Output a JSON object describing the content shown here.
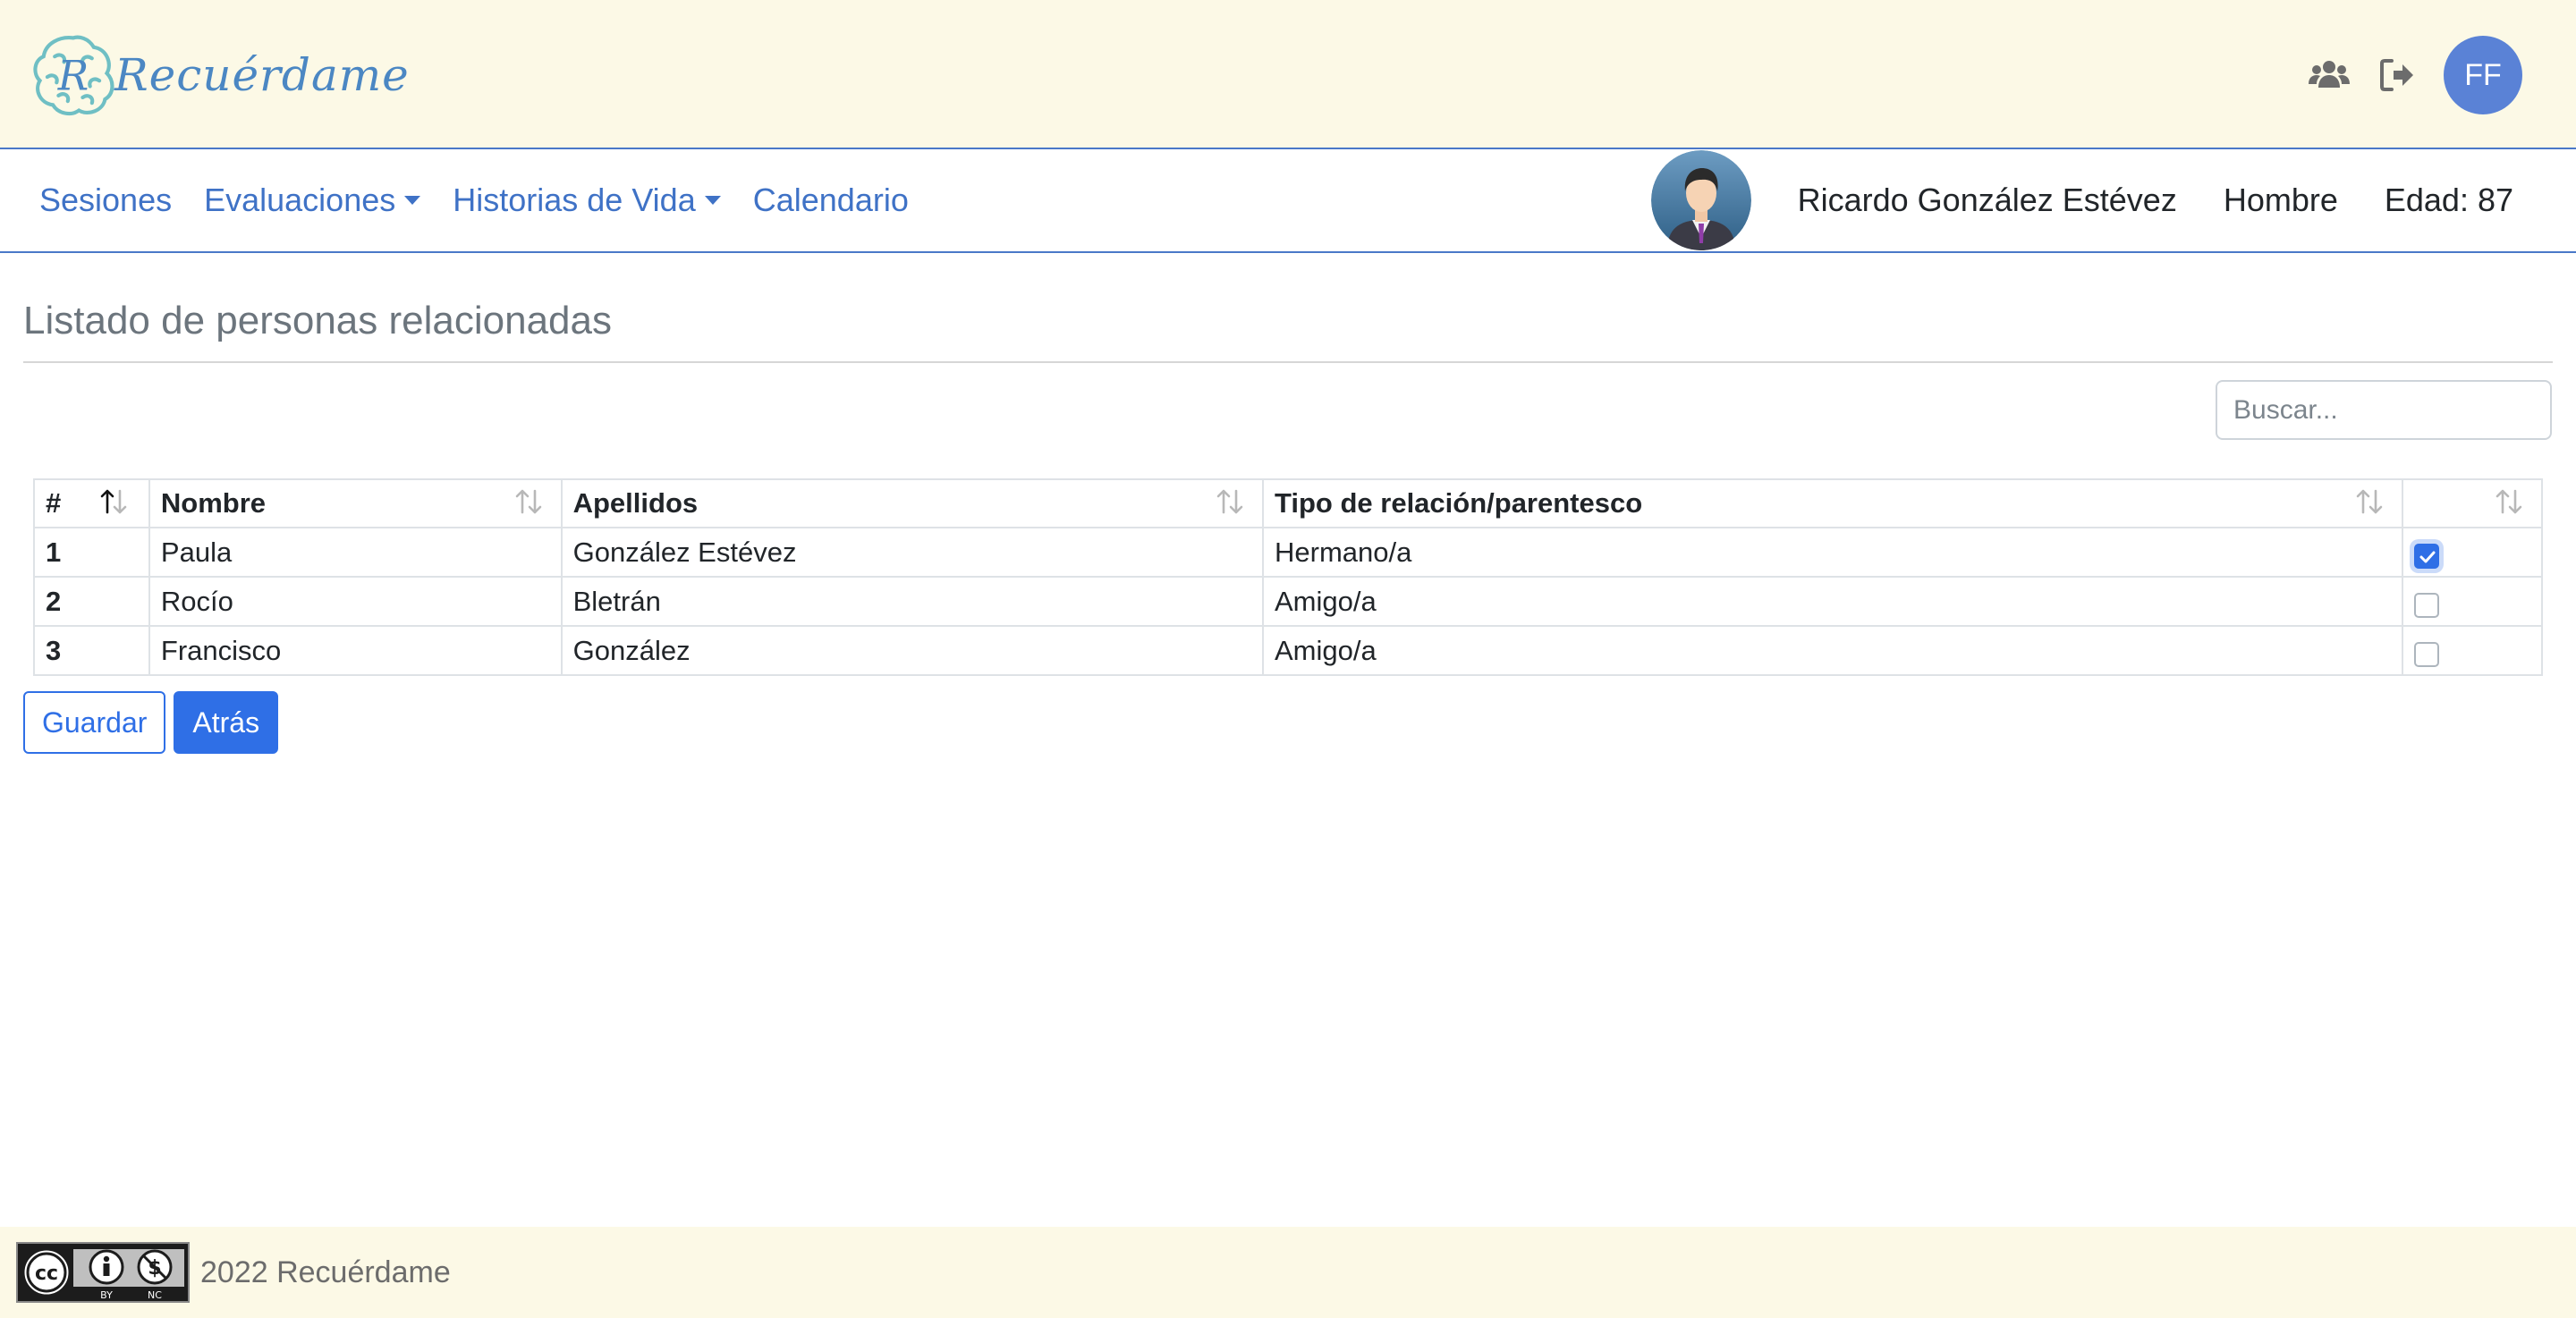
{
  "header": {
    "logo_text": "Recuérdame",
    "user_initials": "FF",
    "icons": [
      "users-icon",
      "logout-icon"
    ]
  },
  "nav": {
    "items": [
      {
        "label": "Sesiones",
        "dropdown": false
      },
      {
        "label": "Evaluaciones",
        "dropdown": true
      },
      {
        "label": "Historias de Vida",
        "dropdown": true
      },
      {
        "label": "Calendario",
        "dropdown": false
      }
    ],
    "patient": {
      "name": "Ricardo González Estévez",
      "gender": "Hombre",
      "age": "Edad: 87"
    }
  },
  "main": {
    "title": "Listado de personas relacionadas",
    "search": {
      "placeholder": "Buscar...",
      "value": ""
    },
    "table": {
      "columns": [
        "#",
        "Nombre",
        "Apellidos",
        "Tipo de relación/parentesco",
        ""
      ],
      "sorted_column": "#",
      "rows": [
        {
          "idx": "1",
          "nombre": "Paula",
          "apellidos": "González Estévez",
          "tipo": "Hermano/a",
          "checked": true
        },
        {
          "idx": "2",
          "nombre": "Rocío",
          "apellidos": "Bletrán",
          "tipo": "Amigo/a",
          "checked": false
        },
        {
          "idx": "3",
          "nombre": "Francisco",
          "apellidos": "González",
          "tipo": "Amigo/a",
          "checked": false
        }
      ]
    },
    "buttons": {
      "save": "Guardar",
      "back": "Atrás"
    }
  },
  "footer": {
    "text": "2022 Recuérdame",
    "license_badge": "CC BY-NC",
    "badge_labels": {
      "by": "BY",
      "nc": "NC"
    }
  },
  "colors": {
    "header_bg": "#fcf9e6",
    "accent": "#2f6fe6",
    "nav_link": "#3f72c6",
    "logo": "#4b87c3",
    "avatar": "#5a82d6"
  }
}
